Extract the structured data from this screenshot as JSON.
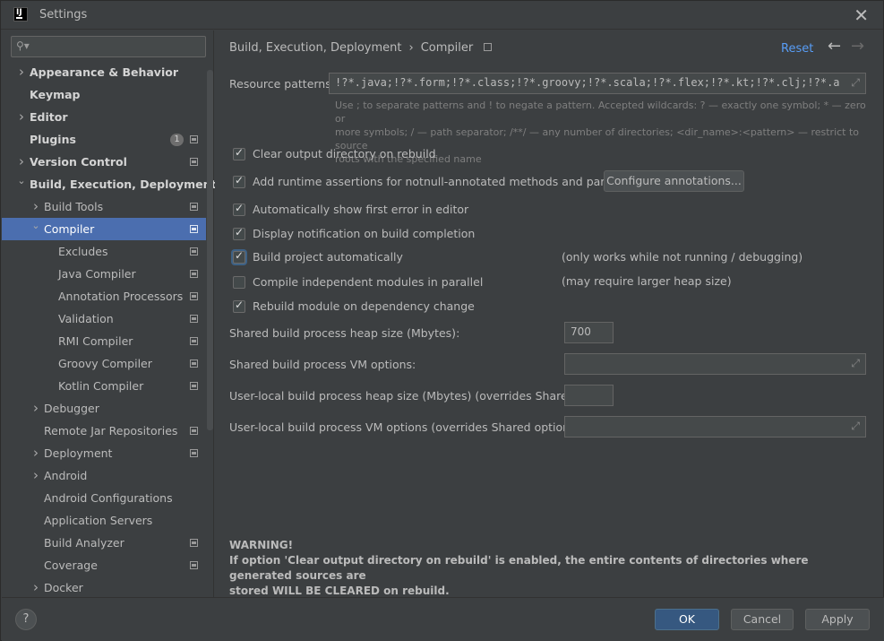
{
  "window": {
    "title": "Settings",
    "app_icon_text": "IJ"
  },
  "sidebar": {
    "search": {
      "value": "",
      "placeholder": ""
    },
    "items": [
      {
        "label": "Appearance & Behavior",
        "level": 0,
        "arrow": "right",
        "bold": true,
        "project": false
      },
      {
        "label": "Keymap",
        "level": 0,
        "arrow": "none",
        "bold": true,
        "project": false
      },
      {
        "label": "Editor",
        "level": 0,
        "arrow": "right",
        "bold": true,
        "project": false
      },
      {
        "label": "Plugins",
        "level": 0,
        "arrow": "none",
        "bold": true,
        "project": true,
        "badge": "1"
      },
      {
        "label": "Version Control",
        "level": 0,
        "arrow": "right",
        "bold": true,
        "project": true
      },
      {
        "label": "Build, Execution, Deployment",
        "level": 0,
        "arrow": "down",
        "bold": true,
        "project": false
      },
      {
        "label": "Build Tools",
        "level": 1,
        "arrow": "right",
        "bold": false,
        "project": true
      },
      {
        "label": "Compiler",
        "level": 1,
        "arrow": "down",
        "bold": false,
        "project": true,
        "selected": true
      },
      {
        "label": "Excludes",
        "level": 2,
        "arrow": "none",
        "bold": false,
        "project": true
      },
      {
        "label": "Java Compiler",
        "level": 2,
        "arrow": "none",
        "bold": false,
        "project": true
      },
      {
        "label": "Annotation Processors",
        "level": 2,
        "arrow": "none",
        "bold": false,
        "project": true
      },
      {
        "label": "Validation",
        "level": 2,
        "arrow": "none",
        "bold": false,
        "project": true
      },
      {
        "label": "RMI Compiler",
        "level": 2,
        "arrow": "none",
        "bold": false,
        "project": true
      },
      {
        "label": "Groovy Compiler",
        "level": 2,
        "arrow": "none",
        "bold": false,
        "project": true
      },
      {
        "label": "Kotlin Compiler",
        "level": 2,
        "arrow": "none",
        "bold": false,
        "project": true
      },
      {
        "label": "Debugger",
        "level": 1,
        "arrow": "right",
        "bold": false,
        "project": false
      },
      {
        "label": "Remote Jar Repositories",
        "level": 1,
        "arrow": "none",
        "bold": false,
        "project": true
      },
      {
        "label": "Deployment",
        "level": 1,
        "arrow": "right",
        "bold": false,
        "project": true
      },
      {
        "label": "Android",
        "level": 1,
        "arrow": "right",
        "bold": false,
        "project": false
      },
      {
        "label": "Android Configurations",
        "level": 1,
        "arrow": "none",
        "bold": false,
        "project": false
      },
      {
        "label": "Application Servers",
        "level": 1,
        "arrow": "none",
        "bold": false,
        "project": false
      },
      {
        "label": "Build Analyzer",
        "level": 1,
        "arrow": "none",
        "bold": false,
        "project": true
      },
      {
        "label": "Coverage",
        "level": 1,
        "arrow": "none",
        "bold": false,
        "project": true
      },
      {
        "label": "Docker",
        "level": 1,
        "arrow": "right",
        "bold": false,
        "project": false
      }
    ]
  },
  "main": {
    "breadcrumb": {
      "parent": "Build, Execution, Deployment",
      "separator": "›",
      "current": "Compiler"
    },
    "reset_label": "Reset",
    "back_icon": "←",
    "forward_icon": "→",
    "resource_patterns": {
      "label": "Resource patterns:",
      "value": "!?*.java;!?*.form;!?*.class;!?*.groovy;!?*.scala;!?*.flex;!?*.kt;!?*.clj;!?*.aj",
      "hint_line1": "Use ; to separate patterns and ! to negate a pattern. Accepted wildcards: ? — exactly one symbol; * — zero or",
      "hint_line2": "more symbols; / — path separator; /**/ — any number of directories; <dir_name>:<pattern> — restrict to source",
      "hint_line3": "roots with the specified name"
    },
    "options": {
      "clear_output": {
        "label": "Clear output directory on rebuild",
        "checked": true
      },
      "runtime_assertions": {
        "label": "Add runtime assertions for notnull-annotated methods and parameters",
        "checked": true
      },
      "configure_annotations": "Configure annotations...",
      "show_first_error": {
        "label": "Automatically show first error in editor",
        "checked": true
      },
      "display_notification": {
        "label": "Display notification on build completion",
        "checked": true
      },
      "build_automatically": {
        "label": "Build project automatically",
        "checked": true,
        "note": "(only works while not running / debugging)"
      },
      "compile_parallel": {
        "label": "Compile independent modules in parallel",
        "checked": false,
        "note": "(may require larger heap size)"
      },
      "rebuild_on_dependency": {
        "label": "Rebuild module on dependency change",
        "checked": true
      }
    },
    "fields": {
      "shared_heap": {
        "label": "Shared build process heap size (Mbytes):",
        "value": "700"
      },
      "shared_vm": {
        "label": "Shared build process VM options:",
        "value": ""
      },
      "user_heap": {
        "label": "User-local build process heap size (Mbytes) (overrides Shared size):",
        "value": ""
      },
      "user_vm": {
        "label": "User-local build process VM options (overrides Shared options):",
        "value": ""
      }
    },
    "warning": {
      "title": "WARNING!",
      "line1": "If option 'Clear output directory on rebuild' is enabled, the entire contents of directories where generated sources are",
      "line2": "stored WILL BE CLEARED on rebuild."
    }
  },
  "footer": {
    "help": "?",
    "ok": "OK",
    "cancel": "Cancel",
    "apply": "Apply"
  },
  "colors": {
    "background": "#3c3f41",
    "selection": "#4b6eaf",
    "link": "#589df6",
    "primary_button": "#365880"
  }
}
